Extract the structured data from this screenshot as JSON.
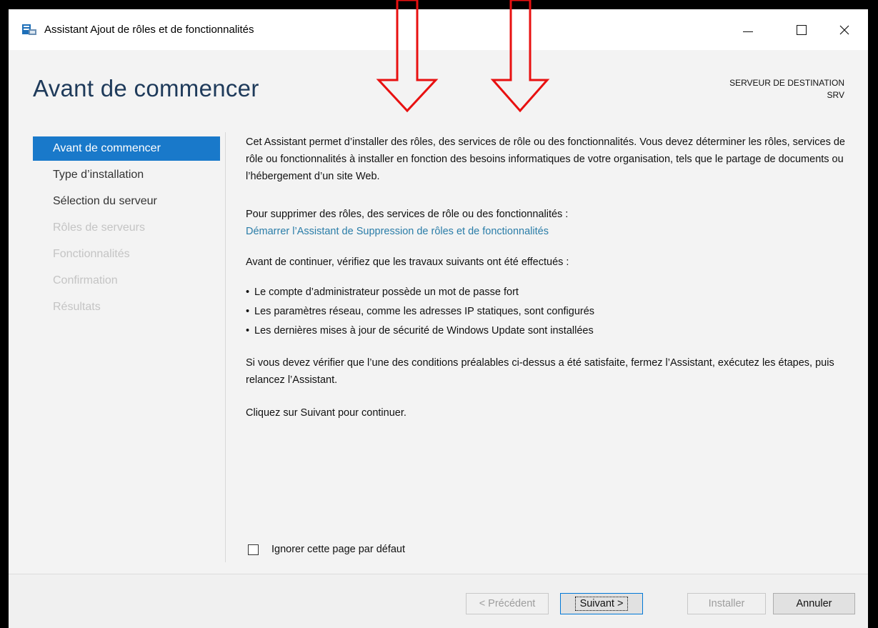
{
  "window": {
    "title": "Assistant Ajout de rôles et de fonctionnalités"
  },
  "header": {
    "heading": "Avant de commencer",
    "destination_label": "SERVEUR DE DESTINATION",
    "destination_server": "SRV"
  },
  "nav": {
    "items": [
      {
        "label": "Avant de commencer",
        "state": "active"
      },
      {
        "label": "Type d’installation",
        "state": "enabled"
      },
      {
        "label": "Sélection du serveur",
        "state": "enabled"
      },
      {
        "label": "Rôles de serveurs",
        "state": "disabled"
      },
      {
        "label": "Fonctionnalités",
        "state": "disabled"
      },
      {
        "label": "Confirmation",
        "state": "disabled"
      },
      {
        "label": "Résultats",
        "state": "disabled"
      }
    ]
  },
  "content": {
    "intro": "Cet Assistant permet d’installer des rôles, des services de rôle ou des fonctionnalités. Vous devez déterminer les rôles, services de rôle ou fonctionnalités à installer en fonction des besoins informatiques de votre organisation, tels que le partage de documents ou l’hébergement d’un site Web.",
    "remove_text": "Pour supprimer des rôles, des services de rôle ou des fonctionnalités :",
    "remove_link": "Démarrer l’Assistant de Suppression de rôles et de fonctionnalités",
    "prereq_intro": "Avant de continuer, vérifiez que les travaux suivants ont été effectués :",
    "bullets": [
      "Le compte d’administrateur possède un mot de passe fort",
      "Les paramètres réseau, comme les adresses IP statiques, sont configurés",
      "Les dernières mises à jour de sécurité de Windows Update sont installées"
    ],
    "conditions_text": "Si vous devez vérifier que l’une des conditions préalables ci-dessus a été satisfaite, fermez l’Assistant, exécutez les étapes, puis relancez l’Assistant.",
    "next_hint": "Cliquez sur Suivant pour continuer.",
    "skip_label": "Ignorer cette page par défaut"
  },
  "buttons": {
    "prev": "< Précédent",
    "next": "Suivant >",
    "install": "Installer",
    "cancel": "Annuler"
  },
  "colors": {
    "accent": "#1979ca",
    "link": "#2a7da8",
    "annotation_arrow": "#e81010"
  }
}
